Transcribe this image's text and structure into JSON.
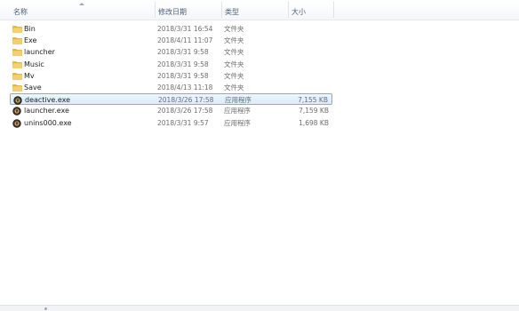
{
  "columns": {
    "name": "名称",
    "date": "修改日期",
    "type": "类型",
    "size": "大小"
  },
  "files": [
    {
      "name": "Bin",
      "date": "2018/3/31 16:54",
      "type": "文件夹",
      "size": "",
      "icon": "folder-icon"
    },
    {
      "name": "Exe",
      "date": "2018/4/11 11:07",
      "type": "文件夹",
      "size": "",
      "icon": "folder-icon"
    },
    {
      "name": "launcher",
      "date": "2018/3/31 9:58",
      "type": "文件夹",
      "size": "",
      "icon": "folder-icon"
    },
    {
      "name": "Music",
      "date": "2018/3/31 9:58",
      "type": "文件夹",
      "size": "",
      "icon": "folder-icon"
    },
    {
      "name": "Mv",
      "date": "2018/3/31 9:58",
      "type": "文件夹",
      "size": "",
      "icon": "folder-icon"
    },
    {
      "name": "Save",
      "date": "2018/4/13 11:18",
      "type": "文件夹",
      "size": "",
      "icon": "folder-icon"
    },
    {
      "name": "deactive.exe",
      "date": "2018/3/26 17:58",
      "type": "应用程序",
      "size": "7,155 KB",
      "icon": "application-icon",
      "selected": true
    },
    {
      "name": "launcher.exe",
      "date": "2018/3/26 17:58",
      "type": "应用程序",
      "size": "7,159 KB",
      "icon": "application-icon"
    },
    {
      "name": "unins000.exe",
      "date": "2018/3/31 9:57",
      "type": "应用程序",
      "size": "1,698 KB",
      "icon": "application-icon"
    }
  ],
  "colors": {
    "selection_fill": "#dcebfc",
    "selection_border": "#84acdd",
    "folder": "#f2c54a",
    "header_text": "#4c607a"
  }
}
